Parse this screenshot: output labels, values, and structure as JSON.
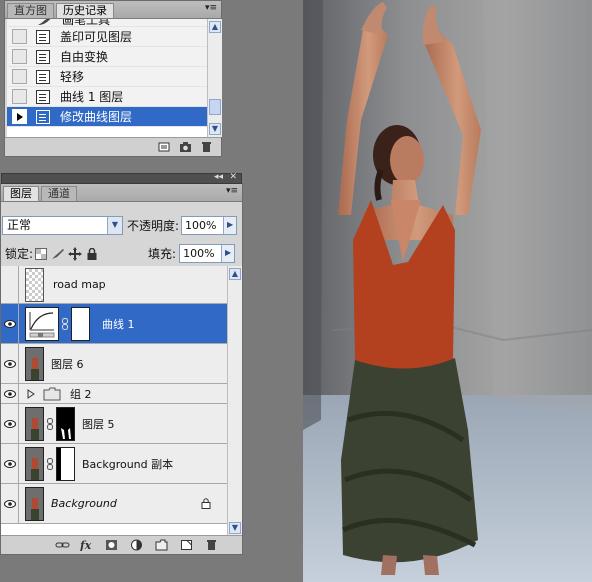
{
  "history_panel": {
    "tabs": [
      "直方图",
      "历史记录"
    ],
    "active_tab": "历史记录",
    "menu_icon": "panel-menu-icon",
    "steps": [
      {
        "label": "画笔工具",
        "icon": "brush-icon"
      },
      {
        "label": "盖印可见图层",
        "icon": "history-step-icon"
      },
      {
        "label": "自由变换",
        "icon": "history-step-icon"
      },
      {
        "label": "轻移",
        "icon": "history-step-icon"
      },
      {
        "label": "曲线 1 图层",
        "icon": "history-step-icon"
      },
      {
        "label": "修改曲线图层",
        "icon": "history-step-icon",
        "selected": true
      }
    ],
    "footer_icons": [
      "new-document-from-state-icon",
      "snapshot-icon",
      "delete-icon"
    ]
  },
  "layers_panel": {
    "tabs": [
      "图层",
      "通道"
    ],
    "active_tab": "图层",
    "blend_mode": "正常",
    "opacity_label": "不透明度:",
    "opacity_value": "100%",
    "lock_label": "锁定:",
    "fill_label": "填充:",
    "fill_value": "100%",
    "layers": [
      {
        "name": "road map",
        "visible": false,
        "type": "pixel-transparent"
      },
      {
        "name": "曲线 1",
        "visible": true,
        "type": "curves-adjustment",
        "selected": true,
        "has_mask": true
      },
      {
        "name": "图层 6",
        "visible": true,
        "type": "pixel"
      },
      {
        "name": "组 2",
        "visible": true,
        "type": "group",
        "collapsed": true
      },
      {
        "name": "图层 5",
        "visible": true,
        "type": "pixel",
        "has_mask": true
      },
      {
        "name": "Background 副本",
        "visible": true,
        "type": "pixel",
        "has_mask": true
      },
      {
        "name": "Background",
        "visible": true,
        "type": "background",
        "locked": true
      }
    ],
    "footer_icons": [
      "link-layers-icon",
      "fx-icon",
      "add-mask-icon",
      "adjustment-layer-icon",
      "new-group-icon",
      "new-layer-icon",
      "delete-icon"
    ]
  },
  "colors": {
    "selection": "#3169c6",
    "panel_bg": "#d6d6d6",
    "canvas_bg": "#7a7a7a"
  }
}
